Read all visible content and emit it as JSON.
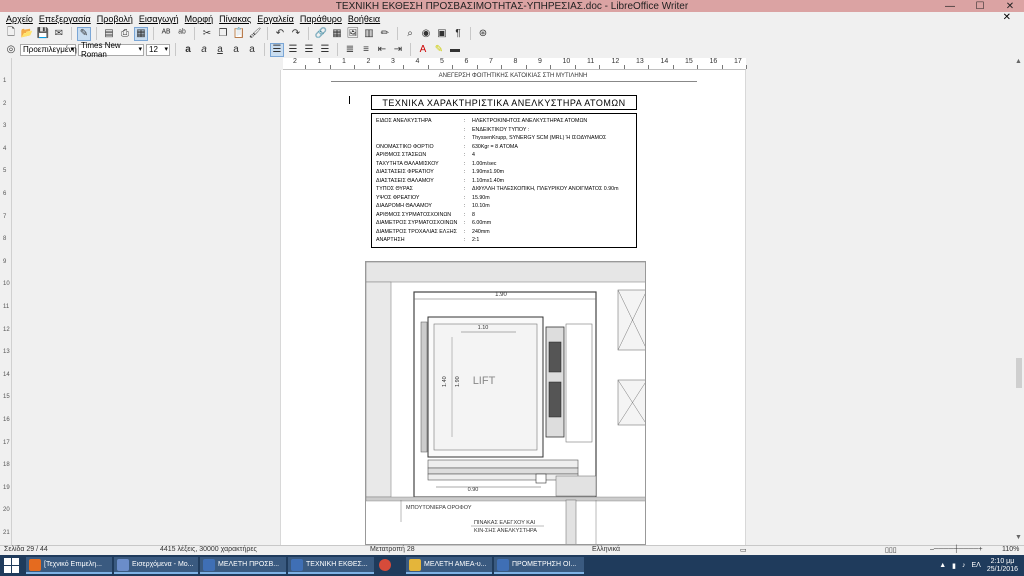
{
  "window": {
    "title": "ΤΕΧΝΙΚΗ ΕΚΘΕΣΗ ΠΡΟΣΒΑΣΙΜΟΤΗΤΑΣ-ΥΠΗΡΕΣΙΑΣ.doc - LibreOffice Writer"
  },
  "menu": [
    "Αρχείο",
    "Επεξεργασία",
    "Προβολή",
    "Εισαγωγή",
    "Μορφή",
    "Πίνακας",
    "Εργαλεία",
    "Παράθυρο",
    "Βοήθεια"
  ],
  "format": {
    "style": "Προεπιλεγμένη",
    "font": "Times New Roman",
    "size": "12"
  },
  "ruler": [
    "2",
    "1",
    "1",
    "2",
    "3",
    "4",
    "5",
    "6",
    "7",
    "8",
    "9",
    "10",
    "11",
    "12",
    "13",
    "14",
    "15",
    "16",
    "17"
  ],
  "vruler": [
    "1",
    "2",
    "3",
    "4",
    "5",
    "6",
    "7",
    "8",
    "9",
    "10",
    "11",
    "12",
    "13",
    "14",
    "15",
    "16",
    "17",
    "18",
    "19",
    "20",
    "21"
  ],
  "doc": {
    "header": "ΑΝΕΓΕΡΣΗ ΦΟΙΤΗΤΙΚΗΣ ΚΑΤΟΙΚΙΑΣ ΣΤΗ ΜΥΤΙΛΗΝΗ",
    "title": "ΤΕΧΝΙΚΑ ΧΑΡΑΚΤΗΡΙΣΤΙΚΑ ΑΝΕΛΚΥΣΤΗΡΑ ΑΤΟΜΩΝ",
    "specs": [
      {
        "k": "ΕΙΔΟΣ ΑΝΕΛΚΥΣΤΗΡΑ",
        "v": "ΗΛΕΚΤΡΟΚΙΝΗΤΟΣ ΑΝΕΛΚΥΣΤΗΡΑΣ ΑΤΟΜΩΝ"
      },
      {
        "k": "",
        "v": "ΕΝΔΕΙΚΤΙΚΟΥ ΤΥΠΟΥ :"
      },
      {
        "k": "",
        "v": "ThyssenKrupp, SYNERGY SCM (MRL) Ή ΙΣΟΔΥΝΑΜΟΣ"
      },
      {
        "k": "ΟΝΟΜΑΣΤΙΚΟ ΦΟΡΤΙΟ",
        "v": "630Kgr = 8 ΑΤΟΜΑ"
      },
      {
        "k": "ΑΡΙΘΜΟΣ ΣΤΑΣΕΩΝ",
        "v": "4"
      },
      {
        "k": "ΤΑΧΥΤΗΤΑ ΘΑΛΑΜΙΣΚΟΥ",
        "v": "1.00m/sec"
      },
      {
        "k": "ΔΙΑΣΤΑΣΕΙΣ ΦΡΕΑΤΙΟΥ",
        "v": "1.90mx1.90m"
      },
      {
        "k": "ΔΙΑΣΤΑΣΕΙΣ ΘΑΛΑΜΟΥ",
        "v": "1.10mx1.40m"
      },
      {
        "k": "ΤΥΠΟΣ ΘΥΡΑΣ",
        "v": "ΔΙΦΥΛΛΗ ΤΗΛΕΣΚΟΠΙΚΗ, ΠΛΕΥΡΙΚΟΥ ΑΝΟΙΓΜΑΤΟΣ 0.90m"
      },
      {
        "k": "ΥΨΟΣ ΦΡΕΑΤΙΟΥ",
        "v": "15.90m"
      },
      {
        "k": "ΔΙΑΔΡΟΜΗ ΘΑΛΑΜΟΥ",
        "v": "10.10m"
      },
      {
        "k": "ΑΡΙΘΜΟΣ ΣΥΡΜΑΤΟΣΧΟΙΝΩΝ",
        "v": "8"
      },
      {
        "k": "ΔΙΑΜΕΤΡΟΣ ΣΥΡΜΑΤΟΣΧΟΙΝΩΝ",
        "v": "6.00mm"
      },
      {
        "k": "ΔΙΑΜΕΤΡΟΣ ΤΡΟΧΑΛΙΑΣ ΕΛΞΗΣ",
        "v": "240mm"
      },
      {
        "k": "ΑΝΑΡΤΗΣΗ",
        "v": "2:1"
      }
    ],
    "drawing": {
      "dim_top": "1.90",
      "dim_inner": "1.10",
      "dim_left": "1.40",
      "dim_left2": "1.90",
      "lift": "LIFT",
      "dim_bottom": "0.90",
      "label_button": "ΜΠΟΥΤΟΝΙΕΡΑ ΟΡΟΦΟΥ",
      "label_panel1": "ΠΙΝΑΚΑΣ ΕΛΕΓΧΟΥ ΚΑΙ",
      "label_panel2": "ΚΙΝ-ΣΗΣ ΑΝΕΛΚΥΣΤΗΡΑ"
    }
  },
  "status": {
    "page": "Σελίδα 29 / 44",
    "words": "4415 λέξεις, 30000 χαρακτήρες",
    "section": "Μετατροπή 28",
    "lang": "Ελληνικά",
    "zoom": "110%"
  },
  "taskbar": {
    "items": [
      {
        "label": "[Τεχνικό Επιμελη...",
        "color": "#e56b1f"
      },
      {
        "label": "Εισερχόμενα - Μο...",
        "color": "#6b8dc9"
      },
      {
        "label": "ΜΕΛΕΤΗ ΠΡΟΣΒ...",
        "color": "#3f6fb5"
      },
      {
        "label": "ΤΕΧΝΙΚΗ ΕΚΘΕΣ...",
        "color": "#3f6fb5"
      },
      {
        "label": "",
        "color": "#d64b3a"
      },
      {
        "label": "ΜΕΛΕΤΗ ΑΜΕΑ-υ...",
        "color": "#e4b53a"
      },
      {
        "label": "ΠΡΟΜΕΤΡΗΣΗ ΟΙ...",
        "color": "#3f6fb5"
      }
    ],
    "lang": "ΕΛ",
    "time": "2:10 μμ",
    "date": "25/1/2016"
  }
}
